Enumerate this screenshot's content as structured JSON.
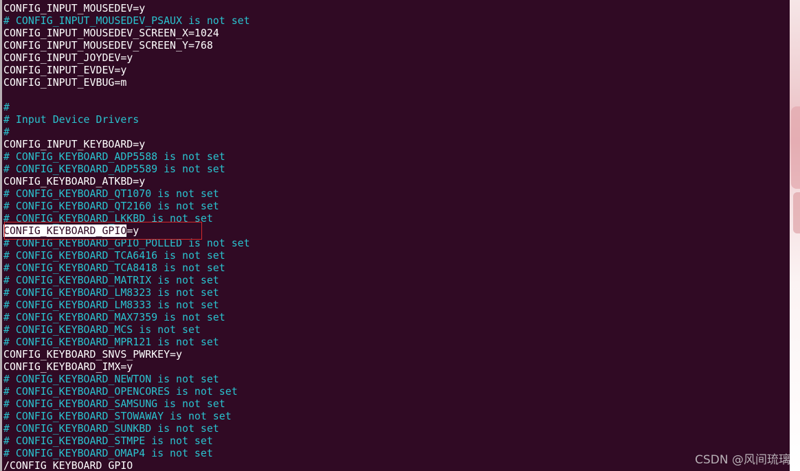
{
  "terminal": {
    "lines": [
      {
        "type": "plain",
        "text": "CONFIG_INPUT_MOUSEDEV=y"
      },
      {
        "type": "comment",
        "text": "# CONFIG_INPUT_MOUSEDEV_PSAUX is not set"
      },
      {
        "type": "plain",
        "text": "CONFIG_INPUT_MOUSEDEV_SCREEN_X=1024"
      },
      {
        "type": "plain",
        "text": "CONFIG_INPUT_MOUSEDEV_SCREEN_Y=768"
      },
      {
        "type": "plain",
        "text": "CONFIG_INPUT_JOYDEV=y"
      },
      {
        "type": "plain",
        "text": "CONFIG_INPUT_EVDEV=y"
      },
      {
        "type": "plain",
        "text": "CONFIG_INPUT_EVBUG=m"
      },
      {
        "type": "blank",
        "text": ""
      },
      {
        "type": "comment",
        "text": "#"
      },
      {
        "type": "comment",
        "text": "# Input Device Drivers"
      },
      {
        "type": "comment",
        "text": "#"
      },
      {
        "type": "plain",
        "text": "CONFIG_INPUT_KEYBOARD=y"
      },
      {
        "type": "comment",
        "text": "# CONFIG_KEYBOARD_ADP5588 is not set"
      },
      {
        "type": "comment",
        "text": "# CONFIG_KEYBOARD_ADP5589 is not set"
      },
      {
        "type": "plain",
        "text": "CONFIG_KEYBOARD_ATKBD=y"
      },
      {
        "type": "comment",
        "text": "# CONFIG_KEYBOARD_QT1070 is not set"
      },
      {
        "type": "comment",
        "text": "# CONFIG_KEYBOARD_QT2160 is not set"
      },
      {
        "type": "comment",
        "text": "# CONFIG_KEYBOARD_LKKBD is not set"
      },
      {
        "type": "match",
        "text": "=y",
        "match": "CONFIG_KEYBOARD_GPIO"
      },
      {
        "type": "comment",
        "text": "# CONFIG_KEYBOARD_GPIO_POLLED is not set"
      },
      {
        "type": "comment",
        "text": "# CONFIG_KEYBOARD_TCA6416 is not set"
      },
      {
        "type": "comment",
        "text": "# CONFIG_KEYBOARD_TCA8418 is not set"
      },
      {
        "type": "comment",
        "text": "# CONFIG_KEYBOARD_MATRIX is not set"
      },
      {
        "type": "comment",
        "text": "# CONFIG_KEYBOARD_LM8323 is not set"
      },
      {
        "type": "comment",
        "text": "# CONFIG_KEYBOARD_LM8333 is not set"
      },
      {
        "type": "comment",
        "text": "# CONFIG_KEYBOARD_MAX7359 is not set"
      },
      {
        "type": "comment",
        "text": "# CONFIG_KEYBOARD_MCS is not set"
      },
      {
        "type": "comment",
        "text": "# CONFIG_KEYBOARD_MPR121 is not set"
      },
      {
        "type": "plain",
        "text": "CONFIG_KEYBOARD_SNVS_PWRKEY=y"
      },
      {
        "type": "plain",
        "text": "CONFIG_KEYBOARD_IMX=y"
      },
      {
        "type": "comment",
        "text": "# CONFIG_KEYBOARD_NEWTON is not set"
      },
      {
        "type": "comment",
        "text": "# CONFIG_KEYBOARD_OPENCORES is not set"
      },
      {
        "type": "comment",
        "text": "# CONFIG_KEYBOARD_SAMSUNG is not set"
      },
      {
        "type": "comment",
        "text": "# CONFIG_KEYBOARD_STOWAWAY is not set"
      },
      {
        "type": "comment",
        "text": "# CONFIG_KEYBOARD_SUNKBD is not set"
      },
      {
        "type": "comment",
        "text": "# CONFIG_KEYBOARD_STMPE is not set"
      },
      {
        "type": "comment",
        "text": "# CONFIG_KEYBOARD_OMAP4 is not set"
      }
    ],
    "search_command": "/CONFIG_KEYBOARD_GPIO"
  },
  "watermark": "CSDN @风间琉璃",
  "colors": {
    "background": "#300a24",
    "comment": "#2ac3cf",
    "text": "#ffffff",
    "annotation_box": "#d62b2b"
  }
}
